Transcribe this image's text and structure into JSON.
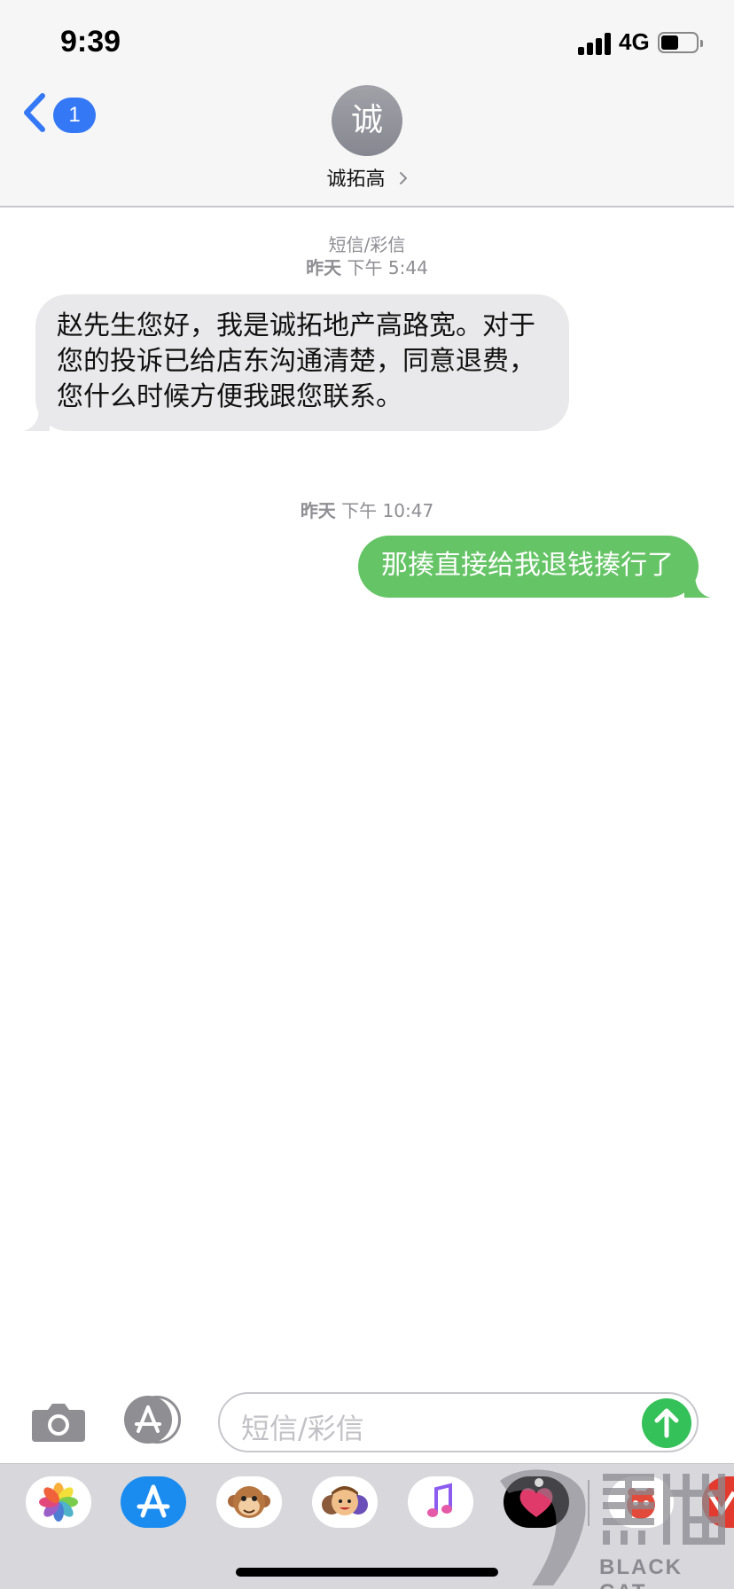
{
  "status_bar": {
    "time": "9:39",
    "network": "4G",
    "battery_level": 0.5
  },
  "nav": {
    "unread_count": "1",
    "contact_initial": "诚",
    "contact_name": "诚拓高"
  },
  "conversation": {
    "service_label": "短信/彩信",
    "first_timestamp_day": "昨天",
    "first_timestamp_time": "下午 5:44",
    "incoming_message": "赵先生您好，我是诚拓地产高路宽。对于您的投诉已给店东沟通清楚，同意退费，您什么时候方便我跟您联系。",
    "second_timestamp_day": "昨天",
    "second_timestamp_time": "下午 10:47",
    "outgoing_message": "那揍直接给我退钱揍行了"
  },
  "compose": {
    "placeholder": "短信/彩信"
  },
  "app_strip": {
    "apps": [
      "photos-app",
      "app-store-app",
      "animoji-app",
      "memoji-app",
      "music-app",
      "digital-touch-app",
      "sticker-app",
      "more-app"
    ]
  },
  "watermark": {
    "brand": "BLACK CAT"
  },
  "colors": {
    "ios_blue": "#3478f6",
    "imessage_green": "#65c466",
    "incoming_gray": "#e9e9eb",
    "send_green": "#35c159"
  }
}
